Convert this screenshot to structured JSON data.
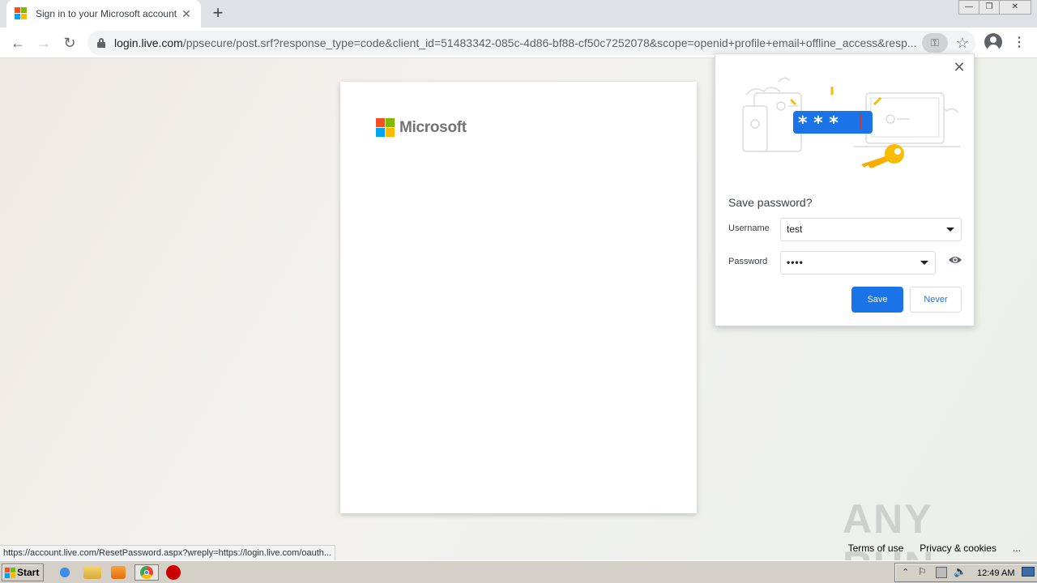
{
  "browser": {
    "tab": {
      "title": "Sign in to your Microsoft account"
    },
    "url": {
      "host": "login.live.com",
      "path": "/ppsecure/post.srf?response_type=code&client_id=51483342-085c-4d86-bf88-cf50c7252078&scope=openid+profile+email+offline_access&resp..."
    },
    "window_controls": {
      "minimize": "—",
      "restore": "❐",
      "close": "✕"
    }
  },
  "page": {
    "brand": "Microsoft",
    "footer": {
      "terms": "Terms of use",
      "privacy": "Privacy & cookies",
      "more": "..."
    },
    "status_url": "https://account.live.com/ResetPassword.aspx?wreply=https://login.live.com/oauth...",
    "watermark": "ANY RUN"
  },
  "password_bubble": {
    "title": "Save password?",
    "username_label": "Username",
    "username_value": "test",
    "password_label": "Password",
    "password_value": "••••",
    "save_label": "Save",
    "never_label": "Never",
    "illustration_text": "* * *"
  },
  "taskbar": {
    "start_label": "Start",
    "clock": "12:49 AM"
  },
  "colors": {
    "accent": "#1a73e8",
    "ms_red": "#f25022",
    "ms_green": "#7fba00",
    "ms_blue": "#00a4ef",
    "ms_yellow": "#ffb900"
  }
}
